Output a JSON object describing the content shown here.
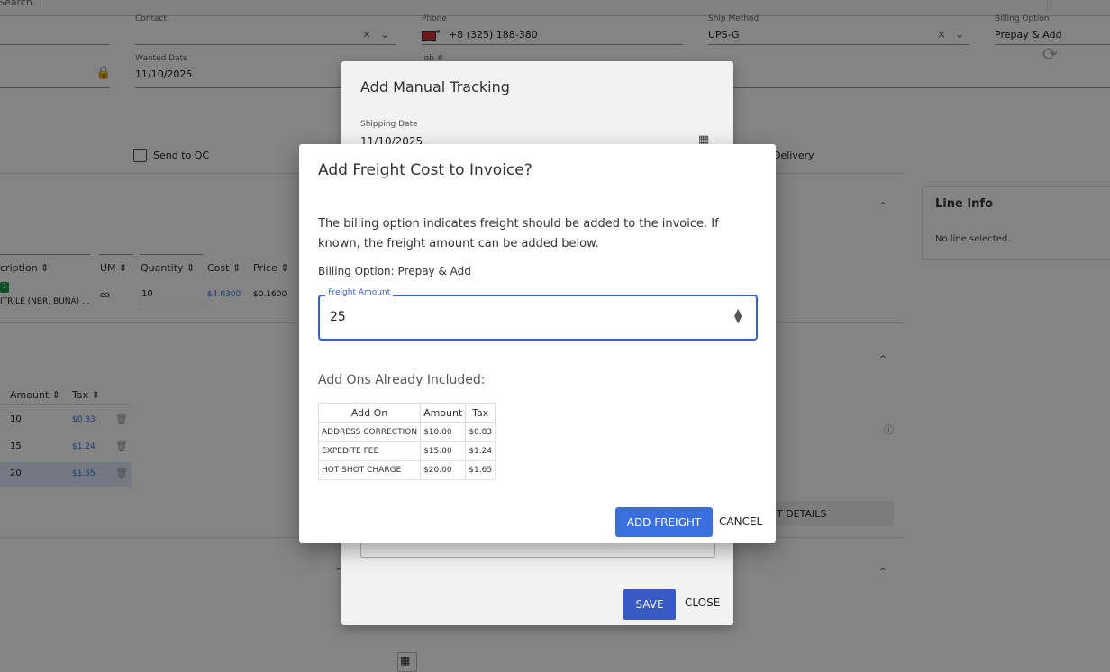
{
  "topbar": {
    "search_text": "Search..."
  },
  "header": {
    "contact_label": "Contact",
    "phone_label": "Phone",
    "phone_value": "+8 (325) 188-380",
    "ship_method_label": "Ship Method",
    "ship_method_value": "UPS-G",
    "billing_option_label": "Billing Option",
    "billing_option_value": "Prepay & Add",
    "wanted_date_label": "Wanted Date",
    "wanted_date_value": "11/10/2025",
    "job_label": "Job #"
  },
  "flags": {
    "send_to_qc": "Send to QC",
    "delivery": "Delivery"
  },
  "lines_table": {
    "headers": [
      "cription",
      "UM",
      "Quantity",
      "Cost",
      "Price"
    ],
    "row": {
      "badge": "1",
      "description": "ITRILE (NBR, BUNA) ...",
      "um": "ea",
      "quantity": "10",
      "cost": "$4.0300",
      "price": "$0.1600"
    }
  },
  "addons_bg": {
    "headers": [
      "Amount",
      "Tax"
    ],
    "rows": [
      {
        "amount": "10",
        "tax": "$0.83"
      },
      {
        "amount": "15",
        "tax": "$1.24"
      },
      {
        "amount": "20",
        "tax": "$1.65"
      }
    ]
  },
  "line_info": {
    "title": "Line Info",
    "empty": "No line selected."
  },
  "details_button": "T DETAILS",
  "tracking_dialog": {
    "title": "Add Manual Tracking",
    "shipping_date_label": "Shipping Date",
    "shipping_date_value": "11/10/2025",
    "save": "SAVE",
    "close": "CLOSE"
  },
  "freight_dialog": {
    "title": "Add Freight Cost to Invoice?",
    "message": "The billing option indicates freight should be added to the invoice. If known, the freight amount can be added below.",
    "billing_option": "Billing Option: Prepay & Add",
    "freight_label": "Freight Amount",
    "freight_value": "25",
    "addons_title": "Add Ons Already Included:",
    "table_headers": [
      "Add On",
      "Amount",
      "Tax"
    ],
    "table_rows": [
      [
        "ADDRESS CORRECTION",
        "$10.00",
        "$0.83"
      ],
      [
        "EXPEDITE FEE",
        "$15.00",
        "$1.24"
      ],
      [
        "HOT SHOT CHARGE",
        "$20.00",
        "$1.65"
      ]
    ],
    "add_button": "ADD FREIGHT",
    "cancel_button": "CANCEL"
  }
}
